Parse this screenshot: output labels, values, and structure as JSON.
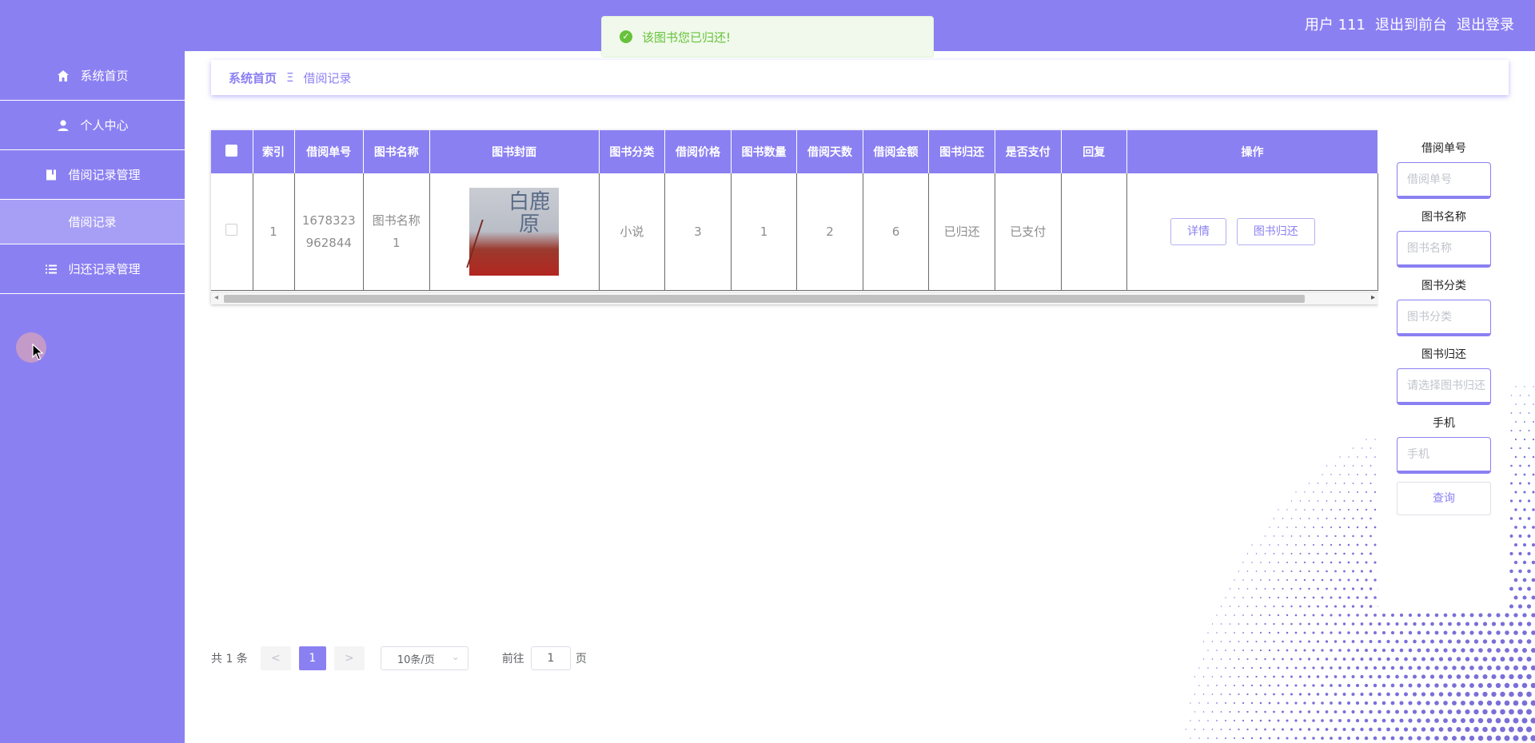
{
  "header": {
    "user": "用户 111",
    "to_front": "退出到前台",
    "logout": "退出登录"
  },
  "toast": {
    "message": "该图书您已归还!"
  },
  "sidebar": {
    "items": [
      {
        "label": "系统首页",
        "icon": "home-icon"
      },
      {
        "label": "个人中心",
        "icon": "user-icon"
      },
      {
        "label": "借阅记录管理",
        "icon": "book-icon"
      },
      {
        "label": "借阅记录",
        "icon": ""
      },
      {
        "label": "归还记录管理",
        "icon": "list-icon"
      }
    ]
  },
  "breadcrumb": {
    "home": "系统首页",
    "sep": "Ξ",
    "current": "借阅记录"
  },
  "table": {
    "headers": [
      "",
      "索引",
      "借阅单号",
      "图书名称",
      "图书封面",
      "图书分类",
      "借阅价格",
      "图书数量",
      "借阅天数",
      "借阅金额",
      "图书归还",
      "是否支付",
      "回复",
      "操作"
    ],
    "rows": [
      {
        "index": "1",
        "order_no": "1678323962844",
        "order_no_l1": "1678323",
        "order_no_l2": "962844",
        "book_name_l1": "图书名称",
        "book_name_l2": "1",
        "cover_title": "白鹿原",
        "category": "小说",
        "price": "3",
        "quantity": "1",
        "days": "2",
        "amount": "6",
        "returned": "已归还",
        "paid": "已支付",
        "reply": "",
        "btn_detail": "详情",
        "btn_return": "图书归还"
      }
    ]
  },
  "search": {
    "order_label": "借阅单号",
    "order_ph": "借阅单号",
    "name_label": "图书名称",
    "name_ph": "图书名称",
    "cat_label": "图书分类",
    "cat_ph": "图书分类",
    "ret_label": "图书归还",
    "ret_ph": "请选择图书归还",
    "phone_label": "手机",
    "phone_ph": "手机",
    "query_btn": "查询"
  },
  "pager": {
    "total": "共 1 条",
    "prev": "<",
    "current": "1",
    "next": ">",
    "size": "10条/页",
    "goto": "前往",
    "goto_value": "1",
    "page_unit": "页"
  },
  "colors": {
    "accent": "#8b80f2",
    "success": "#67c23a"
  }
}
